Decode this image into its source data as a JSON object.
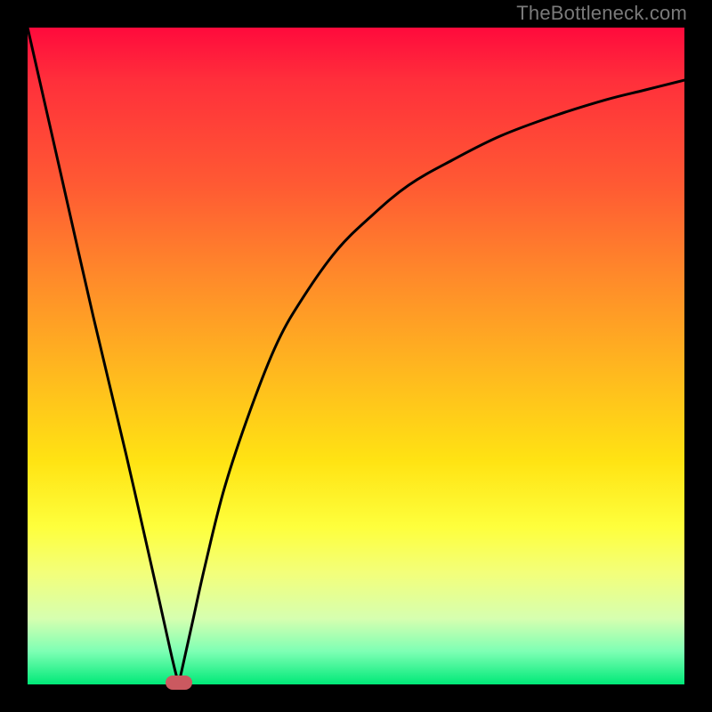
{
  "watermark": {
    "text": "TheBottleneck.com"
  },
  "colors": {
    "background": "#000000",
    "curve": "#000000",
    "marker": "#cb5960",
    "gradient_top": "#ff0a3c",
    "gradient_bottom": "#00e978"
  },
  "chart_data": {
    "type": "line",
    "title": "",
    "xlabel": "",
    "ylabel": "",
    "xlim": [
      0,
      100
    ],
    "ylim": [
      0,
      100
    ],
    "grid": false,
    "legend": false,
    "marker": {
      "x": 23,
      "y": 0
    },
    "series": [
      {
        "name": "left-branch",
        "x": [
          0,
          5,
          10,
          15,
          20,
          22,
          23
        ],
        "values": [
          100,
          78,
          56,
          35,
          13,
          4,
          0
        ]
      },
      {
        "name": "right-branch",
        "x": [
          23,
          25,
          27,
          30,
          34,
          38,
          42,
          47,
          52,
          58,
          65,
          72,
          80,
          88,
          94,
          100
        ],
        "values": [
          0,
          9,
          18,
          30,
          42,
          52,
          59,
          66,
          71,
          76,
          80,
          83.5,
          86.5,
          89,
          90.5,
          92
        ]
      }
    ]
  }
}
